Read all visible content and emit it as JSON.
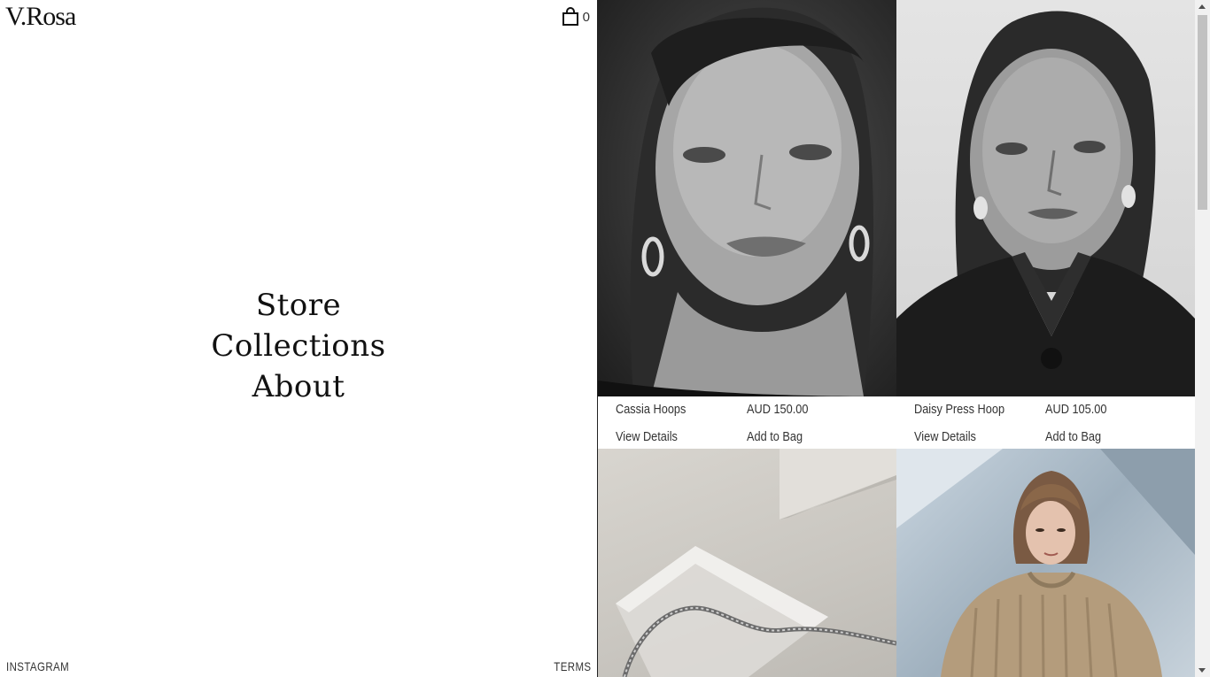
{
  "brand": {
    "logo": "V.Rosa"
  },
  "cart": {
    "count": "0",
    "icon": "shopping-bag-icon"
  },
  "nav": {
    "items": [
      {
        "label": "Store"
      },
      {
        "label": "Collections"
      },
      {
        "label": "About"
      }
    ]
  },
  "footer": {
    "instagram": "INSTAGRAM",
    "terms": "TERMS"
  },
  "products": [
    {
      "name": "Cassia Hoops",
      "price": "AUD 150.00",
      "details": "View Details",
      "add": "Add to Bag"
    },
    {
      "name": "Daisy Press Hoop",
      "price": "AUD 105.00",
      "details": "View Details",
      "add": "Add to Bag"
    }
  ],
  "colors": {
    "text": "#111111",
    "divider": "#222222",
    "background": "#ffffff"
  }
}
